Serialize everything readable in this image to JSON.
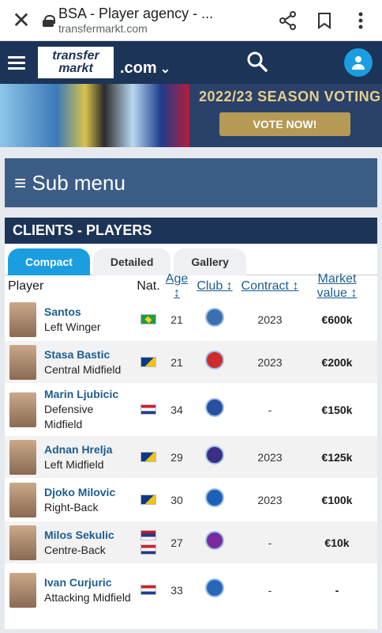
{
  "browser": {
    "title": "BSA - Player agency - ...",
    "url": "transfermarkt.com"
  },
  "nav": {
    "logo_line1": "transfer",
    "logo_line2": "markt",
    "domain": ".com"
  },
  "banner": {
    "title": "2022/23 SEASON VOTING",
    "button": "VOTE NOW!"
  },
  "submenu": {
    "label": "≡ Sub menu"
  },
  "section": {
    "title": "CLIENTS - PLAYERS"
  },
  "tabs": [
    "Compact",
    "Detailed",
    "Gallery"
  ],
  "table": {
    "headers": {
      "player": "Player",
      "nat": "Nat.",
      "age": "Age ↕",
      "club": "Club ↕",
      "contract": "Contract ↕",
      "mv": "Market value ↕"
    },
    "rows": [
      {
        "name": "Santos",
        "pos": "Left Winger",
        "nat": [
          "br"
        ],
        "age": "21",
        "club_color": "#3a6fb0",
        "contract": "2023",
        "mv": "€600k"
      },
      {
        "name": "Stasa Bastic",
        "pos": "Central Midfield",
        "nat": [
          "ba"
        ],
        "age": "21",
        "club_color": "#d12a2a",
        "contract": "2023",
        "mv": "€200k"
      },
      {
        "name": "Marin Ljubicic",
        "pos": "Defensive Midfield",
        "nat": [
          "hr"
        ],
        "age": "34",
        "club_color": "#2750a0",
        "contract": "-",
        "mv": "€150k"
      },
      {
        "name": "Adnan Hrelja",
        "pos": "Left Midfield",
        "nat": [
          "ba"
        ],
        "age": "29",
        "club_color": "#3c2d85",
        "contract": "2023",
        "mv": "€125k"
      },
      {
        "name": "Djoko Milovic",
        "pos": "Right-Back",
        "nat": [
          "ba"
        ],
        "age": "30",
        "club_color": "#1e5fb8",
        "contract": "2023",
        "mv": "€100k"
      },
      {
        "name": "Milos Sekulic",
        "pos": "Centre-Back",
        "nat": [
          "rs",
          "hr"
        ],
        "age": "27",
        "club_color": "#7a2aa0",
        "contract": "-",
        "mv": "€10k"
      },
      {
        "name": "Ivan Curjuric",
        "pos": "Attacking Midfield",
        "nat": [
          "hr"
        ],
        "age": "33",
        "club_color": "#2a66b8",
        "contract": "-",
        "mv": "-"
      }
    ]
  }
}
